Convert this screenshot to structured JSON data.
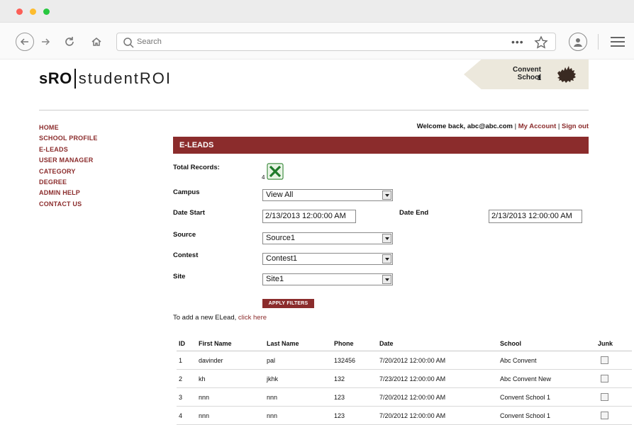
{
  "browser": {
    "search_placeholder": "Search",
    "url_dots": "•••"
  },
  "brand": {
    "short": "sRO",
    "name": "studentROI"
  },
  "school_badge": {
    "name": "Convent School",
    "count": "1"
  },
  "nav": [
    {
      "label": "HOME"
    },
    {
      "label": "SCHOOL PROFILE"
    },
    {
      "label": "E-LEADS"
    },
    {
      "label": "USER MANAGER"
    },
    {
      "label": "CATEGORY"
    },
    {
      "label": "DEGREE"
    },
    {
      "label": "ADMIN HELP"
    },
    {
      "label": "CONTACT US"
    }
  ],
  "welcome": {
    "text": "Welcome back, abc@abc.com",
    "sep1": " | ",
    "account": "My Account",
    "sep2": " |  ",
    "signout": "Sign out"
  },
  "section_title": "E-LEADS",
  "filters": {
    "total_records_label": "Total Records:",
    "total_records_value": "4",
    "campus_label": "Campus",
    "campus_value": "View All",
    "date_start_label": "Date Start",
    "date_start_value": "2/13/2013 12:00:00 AM",
    "date_end_label": "Date End",
    "date_end_value": "2/13/2013 12:00:00 AM",
    "source_label": "Source",
    "source_value": "Source1",
    "contest_label": "Contest",
    "contest_value": "Contest1",
    "site_label": "Site",
    "site_value": "Site1",
    "apply_label": "APPLY FILTERS"
  },
  "add_lead": {
    "prefix": "To add a new ELead, ",
    "link": "click here"
  },
  "table": {
    "headers": [
      "ID",
      "First Name",
      "Last Name",
      "Phone",
      "Date",
      "School",
      "Junk"
    ],
    "rows": [
      [
        "1",
        "davinder",
        "pal",
        "132456",
        "7/20/2012 12:00:00 AM",
        "Abc Convent"
      ],
      [
        "2",
        "kh",
        "jkhk",
        "132",
        "7/23/2012 12:00:00 AM",
        "Abc Convent New"
      ],
      [
        "3",
        "nnn",
        "nnn",
        "123",
        "7/20/2012 12:00:00 AM",
        "Convent School 1"
      ],
      [
        "4",
        "nnn",
        "nnn",
        "123",
        "7/20/2012 12:00:00 AM",
        "Convent School 1"
      ]
    ]
  },
  "colors": {
    "accent": "#8b2c2c",
    "badge_bg": "#ece8dc"
  }
}
